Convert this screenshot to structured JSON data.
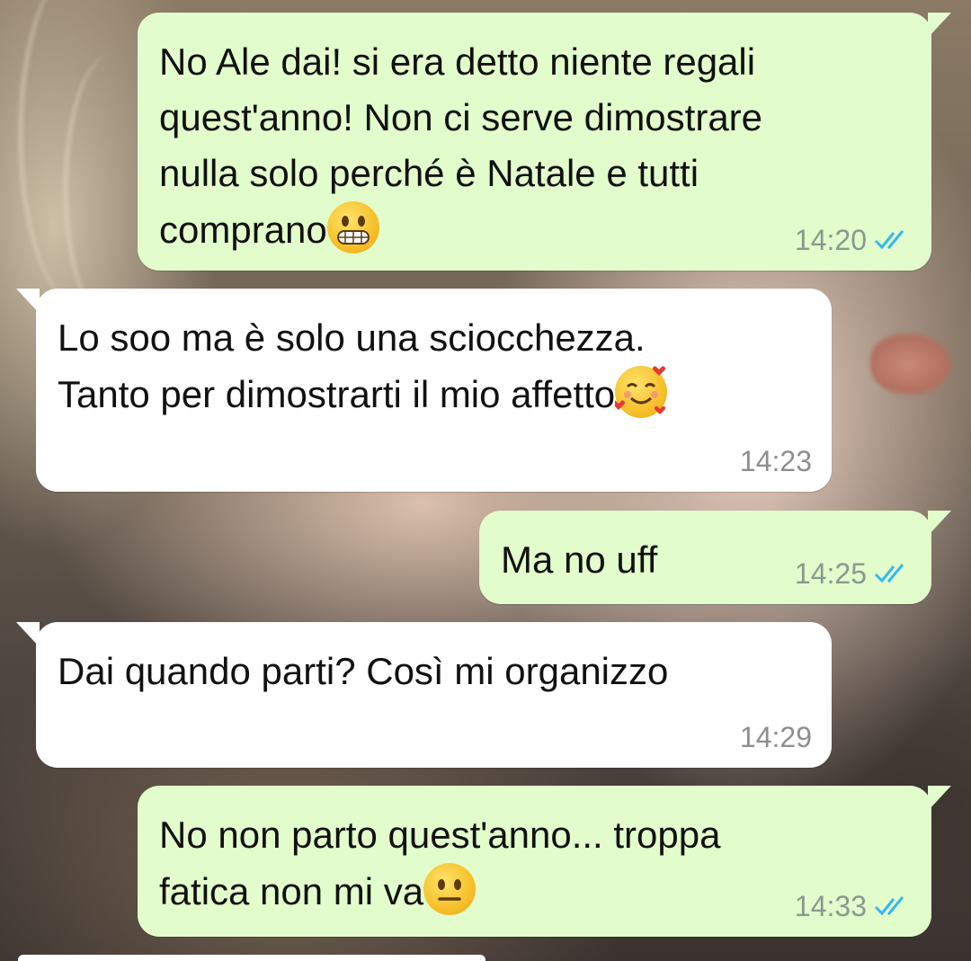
{
  "messages": [
    {
      "direction": "outgoing",
      "lines": [
        "No Ale dai! si era detto niente regali",
        "quest'anno! Non ci serve dimostrare",
        "nulla solo perché è Natale e tutti",
        "comprano"
      ],
      "emoji": "grimacing-face-emoji",
      "time": "14:20",
      "status": "read"
    },
    {
      "direction": "incoming",
      "lines": [
        "Lo soo ma è solo una sciocchezza.",
        "Tanto per dimostrarti il mio affetto"
      ],
      "emoji": "smiling-face-with-hearts-emoji",
      "time": "14:23"
    },
    {
      "direction": "outgoing",
      "lines": [
        "Ma no uff"
      ],
      "time": "14:25",
      "status": "read"
    },
    {
      "direction": "incoming",
      "lines": [
        "Dai quando parti? Così mi organizzo"
      ],
      "time": "14:29"
    },
    {
      "direction": "outgoing",
      "lines": [
        "No non parto quest'anno... troppa",
        "fatica non mi va"
      ],
      "emoji": "neutral-face-emoji",
      "time": "14:33",
      "status": "read"
    }
  ],
  "colors": {
    "outgoing_bubble": "#e2fccb",
    "incoming_bubble": "#ffffff",
    "read_ticks": "#34b7f1",
    "timestamp": "#8a9890"
  }
}
